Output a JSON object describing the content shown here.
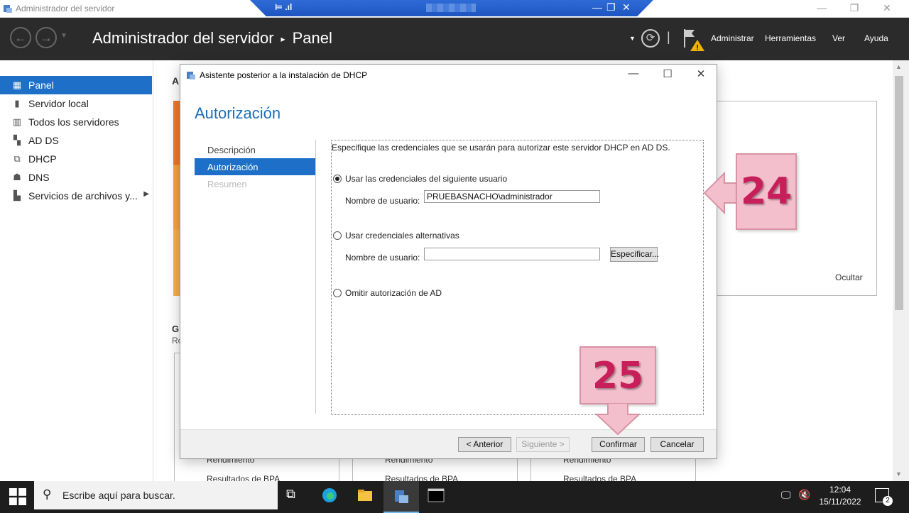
{
  "window": {
    "title": "Administrador del servidor"
  },
  "header": {
    "breadcrumb_root": "Administrador del servidor",
    "breadcrumb_current": "Panel",
    "menu": [
      "Administrar",
      "Herramientas",
      "Ver",
      "Ayuda"
    ]
  },
  "sidebar": {
    "items": [
      {
        "label": "Panel",
        "icon": "dashboard-icon"
      },
      {
        "label": "Servidor local",
        "icon": "server-icon"
      },
      {
        "label": "Todos los servidores",
        "icon": "servers-icon"
      },
      {
        "label": "AD DS",
        "icon": "ad-ds-icon"
      },
      {
        "label": "DHCP",
        "icon": "dhcp-icon"
      },
      {
        "label": "DNS",
        "icon": "dns-icon"
      },
      {
        "label": "Servicios de archivos y...",
        "icon": "file-services-icon"
      }
    ]
  },
  "background": {
    "letter_a": "A",
    "letter_g": "G",
    "letters_ro": "Ro",
    "ocultar": "Ocultar",
    "tiles": [
      {
        "row1": "Rendimiento",
        "row2": "Resultados de BPA"
      },
      {
        "row1": "Rendimiento",
        "row2": "Resultados de BPA"
      },
      {
        "row1": "Rendimiento",
        "row2": "Resultados de BPA"
      }
    ]
  },
  "dialog": {
    "title": "Asistente posterior a la instalación de DHCP",
    "heading": "Autorización",
    "steps": [
      "Descripción",
      "Autorización",
      "Resumen"
    ],
    "instructions": "Especifique las credenciales que se usarán para autorizar este servidor DHCP en AD DS.",
    "option1": "Usar las credenciales del siguiente usuario",
    "username_label": "Nombre de usuario:",
    "username_value": "PRUEBASNACHO\\administrador",
    "option2": "Usar credenciales alternativas",
    "username_label2": "Nombre de usuario:",
    "username_value2": "",
    "specify_button": "Especificar...",
    "option3": "Omitir autorización de AD",
    "buttons": {
      "back": "< Anterior",
      "next": "Siguiente >",
      "confirm": "Confirmar",
      "cancel": "Cancelar"
    }
  },
  "callouts": {
    "step24": "24",
    "step25": "25"
  },
  "taskbar": {
    "search_placeholder": "Escribe aquí para buscar.",
    "time": "12:04",
    "date": "15/11/2022",
    "notification_count": "2"
  },
  "colors": {
    "accent": "#1e6fc8",
    "header_bg": "#2b2b2b",
    "callout_bg": "#f4bfcd",
    "callout_text": "#c81e5a"
  }
}
